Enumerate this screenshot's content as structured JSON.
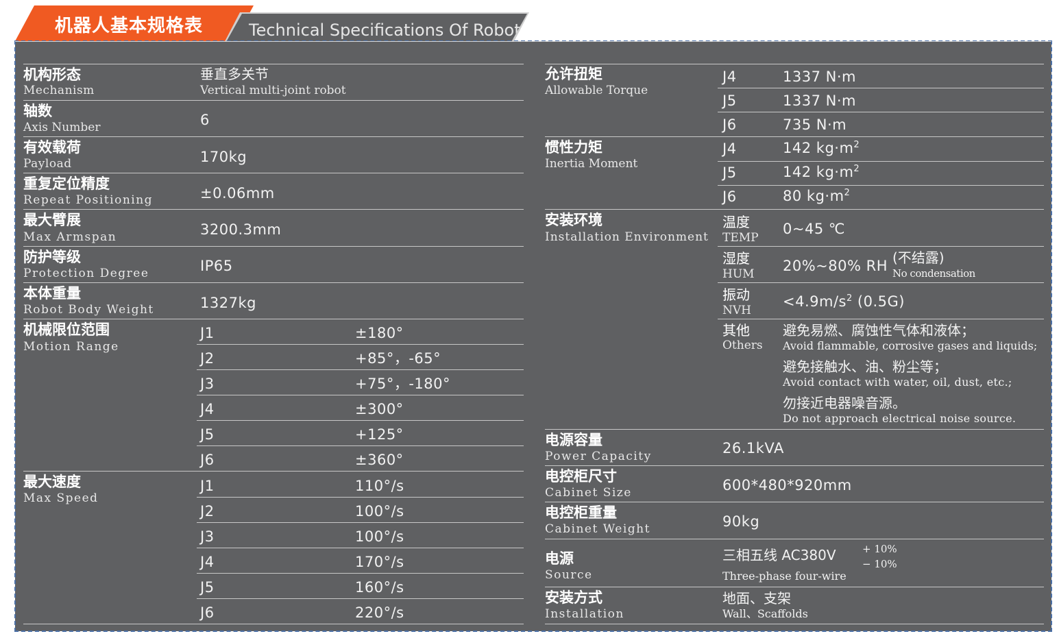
{
  "header": {
    "title_zh": "机器人基本规格表",
    "title_en": "Technical Specifications Of Robot"
  },
  "left": {
    "mechanism": {
      "zh": "机构形态",
      "en": "Mechanism",
      "value_zh": "垂直多关节",
      "value_en": "Vertical multi-joint robot"
    },
    "axis": {
      "zh": "轴数",
      "en": "Axis Number",
      "value": "6"
    },
    "payload": {
      "zh": "有效载荷",
      "en": "Payload",
      "value": "170kg"
    },
    "repeat": {
      "zh": "重复定位精度",
      "en": "Repeat Positioning",
      "value": "±0.06mm"
    },
    "armspan": {
      "zh": "最大臂展",
      "en": "Max Armspan",
      "value": "3200.3mm"
    },
    "protection": {
      "zh": "防护等级",
      "en": "Protection Degree",
      "value": "IP65"
    },
    "weight": {
      "zh": "本体重量",
      "en": "Robot Body Weight",
      "value": "1327kg"
    },
    "motion": {
      "zh": "机械限位范围",
      "en": "Motion Range",
      "rows": [
        {
          "joint": "J1",
          "value": "±180°"
        },
        {
          "joint": "J2",
          "value": "+85°，-65°"
        },
        {
          "joint": "J3",
          "value": "+75°，-180°"
        },
        {
          "joint": "J4",
          "value": "±300°"
        },
        {
          "joint": "J5",
          "value": "+125°"
        },
        {
          "joint": "J6",
          "value": "±360°"
        }
      ]
    },
    "speed": {
      "zh": "最大速度",
      "en": "Max Speed",
      "rows": [
        {
          "joint": "J1",
          "value": "110°/s"
        },
        {
          "joint": "J2",
          "value": "100°/s"
        },
        {
          "joint": "J3",
          "value": "100°/s"
        },
        {
          "joint": "J4",
          "value": "170°/s"
        },
        {
          "joint": "J5",
          "value": "160°/s"
        },
        {
          "joint": "J6",
          "value": "220°/s"
        }
      ]
    }
  },
  "right": {
    "torque": {
      "zh": "允许扭矩",
      "en": "Allowable Torque",
      "rows": [
        {
          "joint": "J4",
          "value": "1337 N·m"
        },
        {
          "joint": "J5",
          "value": "1337 N·m"
        },
        {
          "joint": "J6",
          "value": "735 N·m"
        }
      ]
    },
    "inertia": {
      "zh": "惯性力矩",
      "en": "Inertia Moment",
      "unit_base": "kg·m",
      "unit_sup": "2",
      "rows": [
        {
          "joint": "J4",
          "value": "142"
        },
        {
          "joint": "J5",
          "value": "142"
        },
        {
          "joint": "J6",
          "value": "80"
        }
      ]
    },
    "environment": {
      "zh": "安装环境",
      "en": "Installation Environment",
      "temp": {
        "zh": "温度",
        "en": "TEMP",
        "value": "0~45 ℃"
      },
      "hum": {
        "zh": "湿度",
        "en": "HUM",
        "value": "20%~80% RH",
        "note_zh": "(不结露)",
        "note_en": "No condensation"
      },
      "nvh": {
        "zh": "振动",
        "en": "NVH",
        "value_pre": "<4.9m/s",
        "value_sup": "2",
        "value_post": " (0.5G)"
      },
      "others": {
        "zh": "其他",
        "en": "Others",
        "lines": [
          {
            "zh": "避免易燃、腐蚀性气体和液体；",
            "en": "Avoid flammable, corrosive gases and liquids;"
          },
          {
            "zh": "避免接触水、油、粉尘等；",
            "en": "Avoid contact with water, oil, dust, etc.;"
          },
          {
            "zh": "勿接近电器噪音源。",
            "en": "Do not approach electrical noise source."
          }
        ]
      }
    },
    "power": {
      "zh": "电源容量",
      "en": "Power Capacity",
      "value": "26.1kVA"
    },
    "cabinet_size": {
      "zh": "电控柜尺寸",
      "en": "Cabinet Size",
      "value": "600*480*920mm"
    },
    "cabinet_weight": {
      "zh": "电控柜重量",
      "en": "Cabinet Weight",
      "value": "90kg"
    },
    "source": {
      "zh": "电源",
      "en": "Source",
      "value_zh": "三相五线 AC380V",
      "tol_plus": "+ 10%",
      "tol_minus": "− 10%",
      "value_en": "Three-phase four-wire"
    },
    "installation": {
      "zh": "安装方式",
      "en": "Installation",
      "value_zh": "地面、支架",
      "value_en": "Wall、Scaffolds"
    }
  }
}
